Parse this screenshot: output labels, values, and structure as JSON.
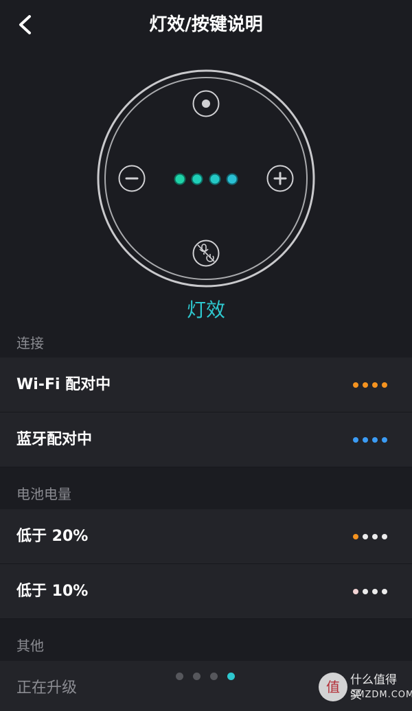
{
  "header": {
    "title": "灯效/按键说明",
    "back_icon": "chevron-left-icon"
  },
  "device": {
    "top_button_icon": "action-dot-icon",
    "left_button_icon": "minus-icon",
    "right_button_icon": "plus-icon",
    "bottom_button_icon": "mic-mute-power-icon",
    "led_colors": [
      "#1fd3a8",
      "#1fcfb8",
      "#24c9c6",
      "#2ac0d4"
    ]
  },
  "mode_label": "灯效",
  "sections": [
    {
      "title": "连接",
      "rows": [
        {
          "label": "Wi-Fi 配对中",
          "dots": [
            "#f5931f",
            "#f5931f",
            "#f5931f",
            "#f5931f"
          ]
        },
        {
          "label": "蓝牙配对中",
          "dots": [
            "#3b9cf5",
            "#3b9cf5",
            "#3b9cf5",
            "#3b9cf5"
          ]
        }
      ]
    },
    {
      "title": "电池电量",
      "rows": [
        {
          "label": "低于 20%",
          "dots": [
            "#f5931f",
            "#ececec",
            "#ececec",
            "#ececec"
          ]
        },
        {
          "label": "低于 10%",
          "dots": [
            "#f2d4d4",
            "#ececec",
            "#ececec",
            "#ececec"
          ]
        }
      ]
    },
    {
      "title": "其他",
      "rows": [
        {
          "label": "正在升级",
          "dots": []
        }
      ]
    }
  ],
  "pager": {
    "count": 4,
    "active_index": 3
  },
  "watermark": {
    "badge_char": "值",
    "line1": "什么值得买",
    "line2": "SMZDM.COM"
  },
  "colors": {
    "background": "#1b1c21",
    "row_background": "#232429",
    "accent": "#2ec8cf",
    "muted_text": "#8b8c92"
  }
}
